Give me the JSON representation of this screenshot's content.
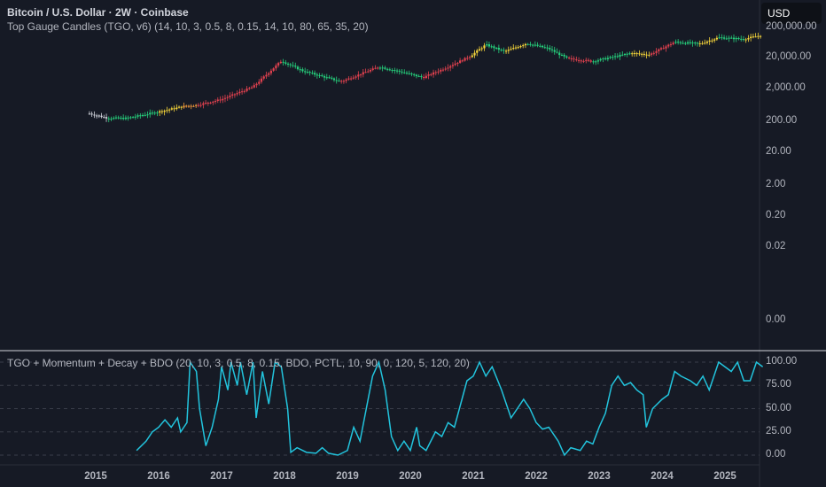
{
  "header": {
    "title": "Bitcoin / U.S. Dollar · 2W · Coinbase",
    "indicator_main": "Top Gauge Candles (TGO, v6) (14, 10, 3, 0.5, 8, 0.15, 14, 10, 80, 65, 35, 20)",
    "indicator_pane": "TGO + Momentum + Decay + BDO (20, 10, 3, 0.5, 8, 0.15, BDO, PCTL, 10, 90, 0, 120, 5, 120, 20)"
  },
  "currency_button": "USD",
  "colors": {
    "bg": "#161a25",
    "osc_line": "#22c4dd",
    "green": "#26d07c",
    "yellow": "#f5d53a",
    "orange": "#f29a3b",
    "red": "#e2414f",
    "white": "#d1d4dc"
  },
  "chart_data": [
    {
      "type": "candlestick",
      "title": "Bitcoin / U.S. Dollar · 2W · Coinbase",
      "yscale": "log",
      "y_ticks": [
        "200,000.00",
        "20,000.00",
        "2,000.00",
        "200.00",
        "20.00",
        "2.00",
        "0.20",
        "0.02",
        "0.00"
      ],
      "x_ticks": [
        "2015",
        "2016",
        "2017",
        "2018",
        "2019",
        "2020",
        "2021",
        "2022",
        "2023",
        "2024",
        "2025"
      ],
      "price_path": [
        [
          2014.9,
          350,
          "white"
        ],
        [
          2015.2,
          250,
          "white"
        ],
        [
          2015.5,
          250,
          "green"
        ],
        [
          2016.0,
          400,
          "green"
        ],
        [
          2016.4,
          600,
          "yellow"
        ],
        [
          2016.6,
          650,
          "orange"
        ],
        [
          2017.0,
          1000,
          "red"
        ],
        [
          2017.5,
          2500,
          "red"
        ],
        [
          2017.95,
          17000,
          "red"
        ],
        [
          2018.3,
          8000,
          "green"
        ],
        [
          2018.9,
          3700,
          "green"
        ],
        [
          2019.5,
          11000,
          "red"
        ],
        [
          2019.9,
          7200,
          "green"
        ],
        [
          2020.2,
          5000,
          "green"
        ],
        [
          2020.6,
          11000,
          "red"
        ],
        [
          2020.95,
          24000,
          "red"
        ],
        [
          2021.2,
          56000,
          "yellow"
        ],
        [
          2021.5,
          34000,
          "green"
        ],
        [
          2021.85,
          62000,
          "yellow"
        ],
        [
          2022.2,
          42000,
          "green"
        ],
        [
          2022.5,
          20000,
          "green"
        ],
        [
          2022.9,
          16500,
          "red"
        ],
        [
          2023.5,
          30000,
          "green"
        ],
        [
          2023.8,
          27000,
          "yellow"
        ],
        [
          2024.2,
          68000,
          "red"
        ],
        [
          2024.6,
          60000,
          "green"
        ],
        [
          2024.9,
          95000,
          "yellow"
        ],
        [
          2025.3,
          85000,
          "green"
        ],
        [
          2025.6,
          115000,
          "yellow"
        ]
      ]
    },
    {
      "type": "line",
      "title": "TGO + Momentum + Decay + BDO",
      "y_ticks": [
        "100.00",
        "75.00",
        "50.00",
        "25.00",
        "0.00"
      ],
      "ylim": [
        0,
        100
      ],
      "series": [
        {
          "name": "TGO",
          "x": [
            2015.65,
            2015.8,
            2015.9,
            2016.0,
            2016.1,
            2016.2,
            2016.3,
            2016.35,
            2016.45,
            2016.5,
            2016.6,
            2016.65,
            2016.75,
            2016.85,
            2016.95,
            2017.0,
            2017.1,
            2017.15,
            2017.25,
            2017.3,
            2017.4,
            2017.5,
            2017.55,
            2017.65,
            2017.75,
            2017.85,
            2017.95,
            2018.05,
            2018.1,
            2018.2,
            2018.35,
            2018.5,
            2018.6,
            2018.7,
            2018.85,
            2019.0,
            2019.1,
            2019.2,
            2019.3,
            2019.4,
            2019.5,
            2019.6,
            2019.7,
            2019.8,
            2019.9,
            2020.0,
            2020.1,
            2020.15,
            2020.25,
            2020.4,
            2020.5,
            2020.6,
            2020.7,
            2020.8,
            2020.9,
            2021.0,
            2021.1,
            2021.2,
            2021.3,
            2021.45,
            2021.6,
            2021.7,
            2021.8,
            2021.9,
            2022.0,
            2022.1,
            2022.2,
            2022.35,
            2022.45,
            2022.55,
            2022.7,
            2022.8,
            2022.9,
            2023.0,
            2023.1,
            2023.2,
            2023.3,
            2023.4,
            2023.5,
            2023.6,
            2023.7,
            2023.75,
            2023.85,
            2024.0,
            2024.1,
            2024.2,
            2024.3,
            2024.45,
            2024.55,
            2024.65,
            2024.75,
            2024.85,
            2024.9,
            2025.0,
            2025.1,
            2025.2,
            2025.3,
            2025.4,
            2025.5,
            2025.6
          ],
          "values": [
            5,
            15,
            25,
            30,
            38,
            30,
            40,
            25,
            35,
            100,
            90,
            50,
            10,
            30,
            60,
            95,
            70,
            100,
            75,
            100,
            65,
            100,
            40,
            90,
            55,
            100,
            95,
            50,
            3,
            8,
            3,
            2,
            8,
            2,
            0,
            5,
            30,
            15,
            50,
            85,
            100,
            70,
            20,
            5,
            15,
            5,
            30,
            10,
            5,
            25,
            20,
            35,
            30,
            55,
            80,
            85,
            100,
            85,
            95,
            70,
            40,
            50,
            60,
            50,
            35,
            28,
            30,
            15,
            0,
            8,
            5,
            15,
            12,
            30,
            45,
            75,
            85,
            75,
            78,
            70,
            65,
            30,
            50,
            60,
            65,
            90,
            85,
            80,
            75,
            85,
            70,
            90,
            100,
            95,
            90,
            100,
            80,
            80,
            100,
            95
          ]
        }
      ]
    }
  ]
}
